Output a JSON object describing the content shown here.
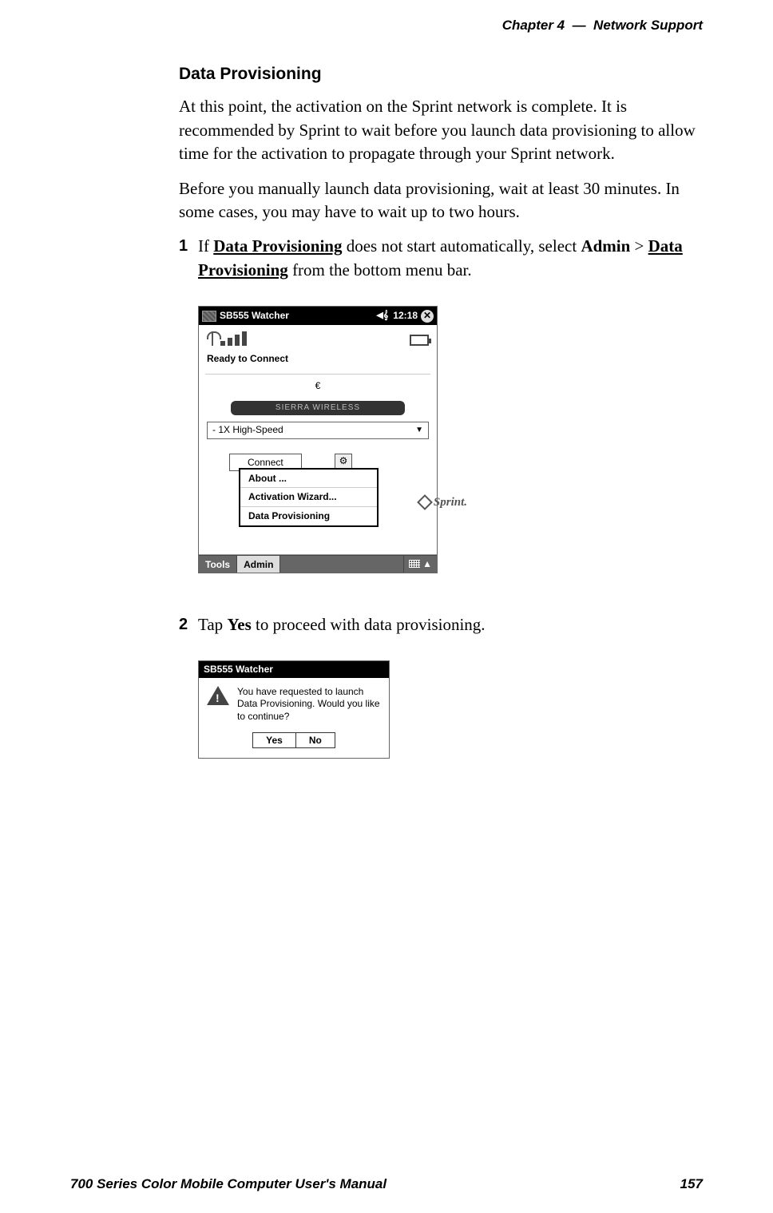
{
  "header": {
    "chapter": "Chapter",
    "chapterNum": "4",
    "sep": "—",
    "title": "Network Support"
  },
  "footer": {
    "manual": "700 Series Color Mobile Computer User's Manual",
    "page": "157"
  },
  "section": {
    "heading": "Data Provisioning"
  },
  "para1": "At this point, the activation on the Sprint network is complete. It is recommended by Sprint to wait before you launch data provisioning to allow time for the activation to propagate through your Sprint network.",
  "para2": "Before you manually launch data provisioning, wait at least 30 minutes. In some cases, you may have to wait up to two hours.",
  "step1": {
    "num": "1",
    "pre": "If ",
    "b1": "Data Provisioning",
    "mid1": " does not start automatically, select ",
    "b2": "Admin",
    "gt": " > ",
    "b3": "Data Provisioning",
    "post": " from the bottom menu bar."
  },
  "step2": {
    "num": "2",
    "pre": "Tap ",
    "b1": "Yes",
    "post": " to proceed with data provisioning."
  },
  "shot1": {
    "title": "SB555 Watcher",
    "time": "12:18",
    "status": "Ready to Connect",
    "euro": "€",
    "brand": "SIERRA WIRELESS",
    "combo": "- 1X High-Speed",
    "connect": "Connect",
    "menu": {
      "about": "About ...",
      "wizard": "Activation Wizard...",
      "provision": "Data Provisioning"
    },
    "sprint": "Sprint.",
    "bottom": {
      "tools": "Tools",
      "admin": "Admin"
    }
  },
  "shot2": {
    "title": "SB555 Watcher",
    "msg": "You have requested to launch Data Provisioning. Would you like to continue?",
    "yes": "Yes",
    "no": "No"
  }
}
